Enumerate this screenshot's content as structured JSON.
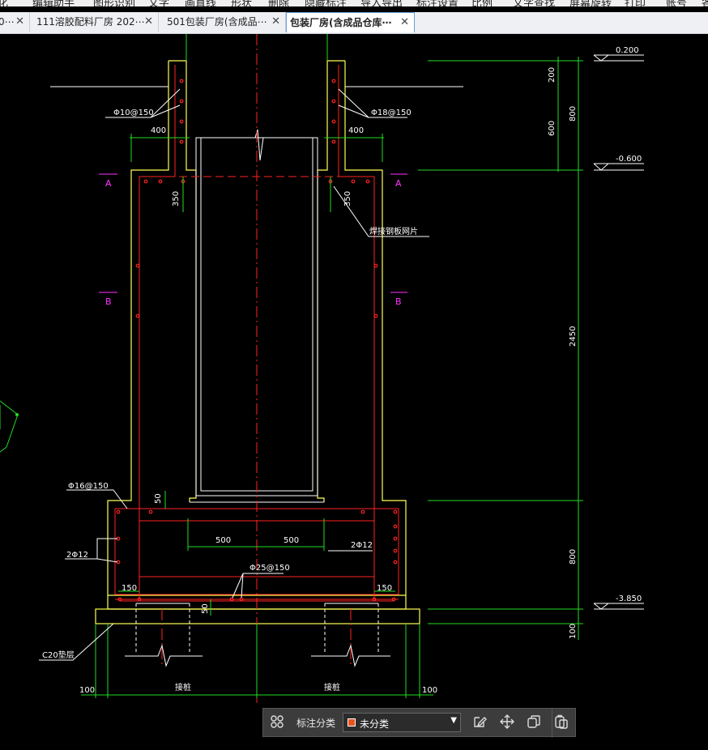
{
  "menu": [
    "化",
    "编辑助手",
    "图形识别",
    "文字",
    "画直线",
    "形状",
    "删除",
    "隐藏标注",
    "导入导出",
    "标注设置",
    "比例",
    "文字查找",
    "屏幕旋转",
    "打印",
    "账号",
    "各"
  ],
  "tabs": [
    {
      "label": "0⋯",
      "active": false
    },
    {
      "label": "111溶胶配料厂房 202⋯",
      "active": false
    },
    {
      "label": "501包装厂房(含成品⋯",
      "active": false
    },
    {
      "label": "包装厂房(含成品仓库⋯",
      "active": true
    }
  ],
  "close_glyph": "✕",
  "drawing": {
    "elev_top": "0.200",
    "elev_mid": "-0.600",
    "elev_bot": "-3.850",
    "dims": {
      "d200": "200",
      "d800a": "800",
      "d600": "600",
      "d2450": "2450",
      "d800b": "800",
      "d100v": "100",
      "d400l": "400",
      "d400r": "400",
      "d350l": "350",
      "d350r": "350",
      "d50a": "50",
      "d50b": "50",
      "d500l": "500",
      "d500r": "500",
      "d150l": "150",
      "d150r": "150",
      "d100l": "100",
      "d100r": "100"
    },
    "rebar": {
      "r10": "Φ10@150",
      "r18": "Φ18@150",
      "r16": "Φ16@150",
      "r12l": "2Φ12",
      "r12r": "2Φ12",
      "r25": "Φ25@150"
    },
    "notes": {
      "weld": "焊接钢板网片",
      "c20": "C20垫层",
      "pile_l": "接桩",
      "pile_r": "接桩"
    },
    "sections": {
      "a": "A",
      "b": "B"
    }
  },
  "toolbar": {
    "label": "标注分类",
    "category": "未分类",
    "category_color": "#e8541e"
  },
  "colors": {
    "green": "#22dd22",
    "yellow": "#ffff55",
    "red": "#ff2222",
    "magenta": "#ff33ff",
    "white": "#ffffff"
  }
}
